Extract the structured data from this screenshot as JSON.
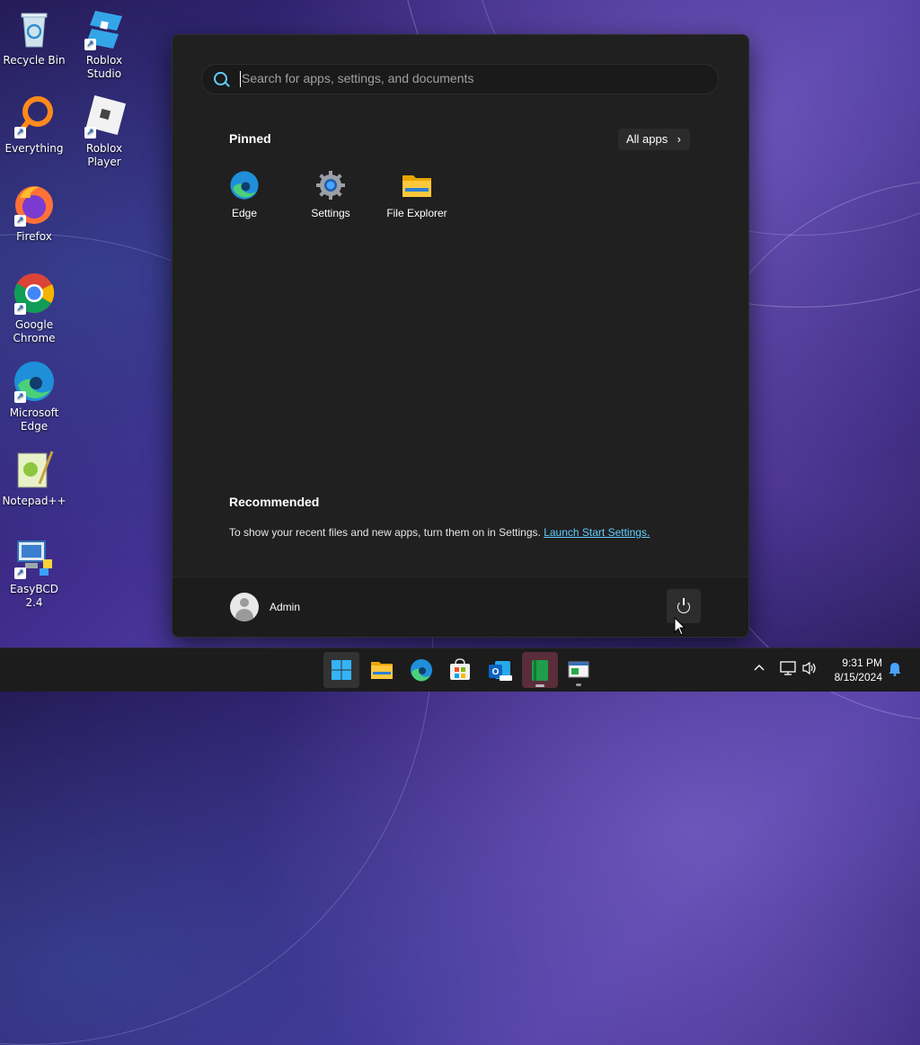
{
  "desktop": {
    "icons": [
      {
        "label": "Recycle Bin",
        "icon": "recycle-bin-icon"
      },
      {
        "label": "Roblox Studio",
        "icon": "roblox-studio-icon"
      },
      {
        "label": "Everything",
        "icon": "everything-icon"
      },
      {
        "label": "Roblox Player",
        "icon": "roblox-player-icon"
      },
      {
        "label": "Firefox",
        "icon": "firefox-icon"
      },
      {
        "label": "Google Chrome",
        "icon": "chrome-icon"
      },
      {
        "label": "Microsoft Edge",
        "icon": "edge-icon"
      },
      {
        "label": "Notepad++",
        "icon": "notepad-plus-plus-icon"
      },
      {
        "label": "EasyBCD 2.4",
        "icon": "easybcd-icon"
      }
    ]
  },
  "start_menu": {
    "search": {
      "placeholder": "Search for apps, settings, and documents",
      "value": ""
    },
    "pinned": {
      "title": "Pinned",
      "all_apps_label": "All apps",
      "apps": [
        {
          "label": "Edge",
          "icon": "edge-icon"
        },
        {
          "label": "Settings",
          "icon": "settings-gear-icon"
        },
        {
          "label": "File Explorer",
          "icon": "folder-icon"
        }
      ]
    },
    "recommended": {
      "title": "Recommended",
      "text": "To show your recent files and new apps, turn them on in Settings.",
      "link": "Launch Start Settings."
    },
    "user": {
      "name": "Admin"
    },
    "power_icon": "power-icon"
  },
  "taskbar": {
    "apps": [
      {
        "name": "start",
        "icon": "windows-logo-icon"
      },
      {
        "name": "file-explorer",
        "icon": "folder-icon"
      },
      {
        "name": "edge",
        "icon": "edge-icon"
      },
      {
        "name": "microsoft-store",
        "icon": "store-icon"
      },
      {
        "name": "outlook-new",
        "icon": "outlook-icon"
      },
      {
        "name": "green-app",
        "icon": "green-book-icon"
      },
      {
        "name": "window-app",
        "icon": "window-app-icon"
      }
    ],
    "tray": {
      "time": "9:31 PM",
      "date": "8/15/2024"
    }
  },
  "colors": {
    "accent": "#60cdff",
    "start_bg": "#202020",
    "taskbar_bg": "#1c1c1c"
  }
}
